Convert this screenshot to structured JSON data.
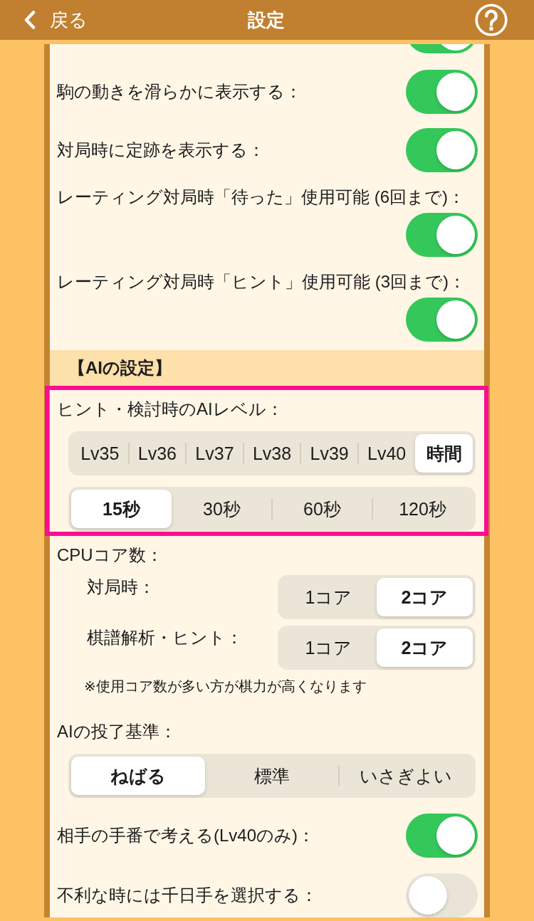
{
  "header": {
    "back_label": "戻る",
    "title": "設定"
  },
  "general": {
    "partial_toggle": {
      "on": true
    },
    "items": [
      {
        "kind": "toggle_inline",
        "label": "駒の動きを滑らかに表示する：",
        "on": true
      },
      {
        "kind": "toggle_inline",
        "label": "対局時に定跡を表示する：",
        "on": true
      },
      {
        "kind": "toggle_stacked",
        "label": "レーティング対局時「待った」使用可能 (6回まで)：",
        "on": true
      },
      {
        "kind": "toggle_stacked",
        "label": "レーティング対局時「ヒント」使用可能 (3回まで)：",
        "on": true
      }
    ]
  },
  "ai_section": {
    "heading": "【AIの設定】",
    "items": [
      {
        "kind": "segmented",
        "highlighted": true,
        "label": "ヒント・検討時のAIレベル：",
        "rows": [
          {
            "options": [
              {
                "label": "Lv35",
                "selected": false
              },
              {
                "label": "Lv36",
                "selected": false
              },
              {
                "label": "Lv37",
                "selected": false
              },
              {
                "label": "Lv38",
                "selected": false
              },
              {
                "label": "Lv39",
                "selected": false
              },
              {
                "label": "Lv40",
                "selected": false
              },
              {
                "label": "時間",
                "selected": true
              }
            ]
          },
          {
            "options": [
              {
                "label": "15秒",
                "selected": true
              },
              {
                "label": "30秒",
                "selected": false
              },
              {
                "label": "60秒",
                "selected": false
              },
              {
                "label": "120秒",
                "selected": false
              }
            ]
          }
        ]
      },
      {
        "kind": "group",
        "highlighted": false,
        "label": "CPUコア数：",
        "subitems": [
          {
            "label": "対局時：",
            "options": [
              {
                "label": "1コア",
                "selected": false
              },
              {
                "label": "2コア",
                "selected": true
              }
            ]
          },
          {
            "label": "棋譜解析・ヒント：",
            "options": [
              {
                "label": "1コア",
                "selected": false
              },
              {
                "label": "2コア",
                "selected": true
              }
            ]
          }
        ],
        "note": "※使用コア数が多い方が棋力が高くなります"
      },
      {
        "kind": "segmented",
        "highlighted": false,
        "label": "AIの投了基準：",
        "rows": [
          {
            "options": [
              {
                "label": "ねばる",
                "selected": true
              },
              {
                "label": "標準",
                "selected": false
              },
              {
                "label": "いさぎよい",
                "selected": false
              }
            ]
          }
        ]
      },
      {
        "kind": "toggle_inline",
        "highlighted": false,
        "label": "相手の手番で考える(Lv40のみ)：",
        "on": true
      },
      {
        "kind": "toggle_inline",
        "highlighted": false,
        "label": "不利な時には千日手を選択する：",
        "on": false
      }
    ]
  }
}
